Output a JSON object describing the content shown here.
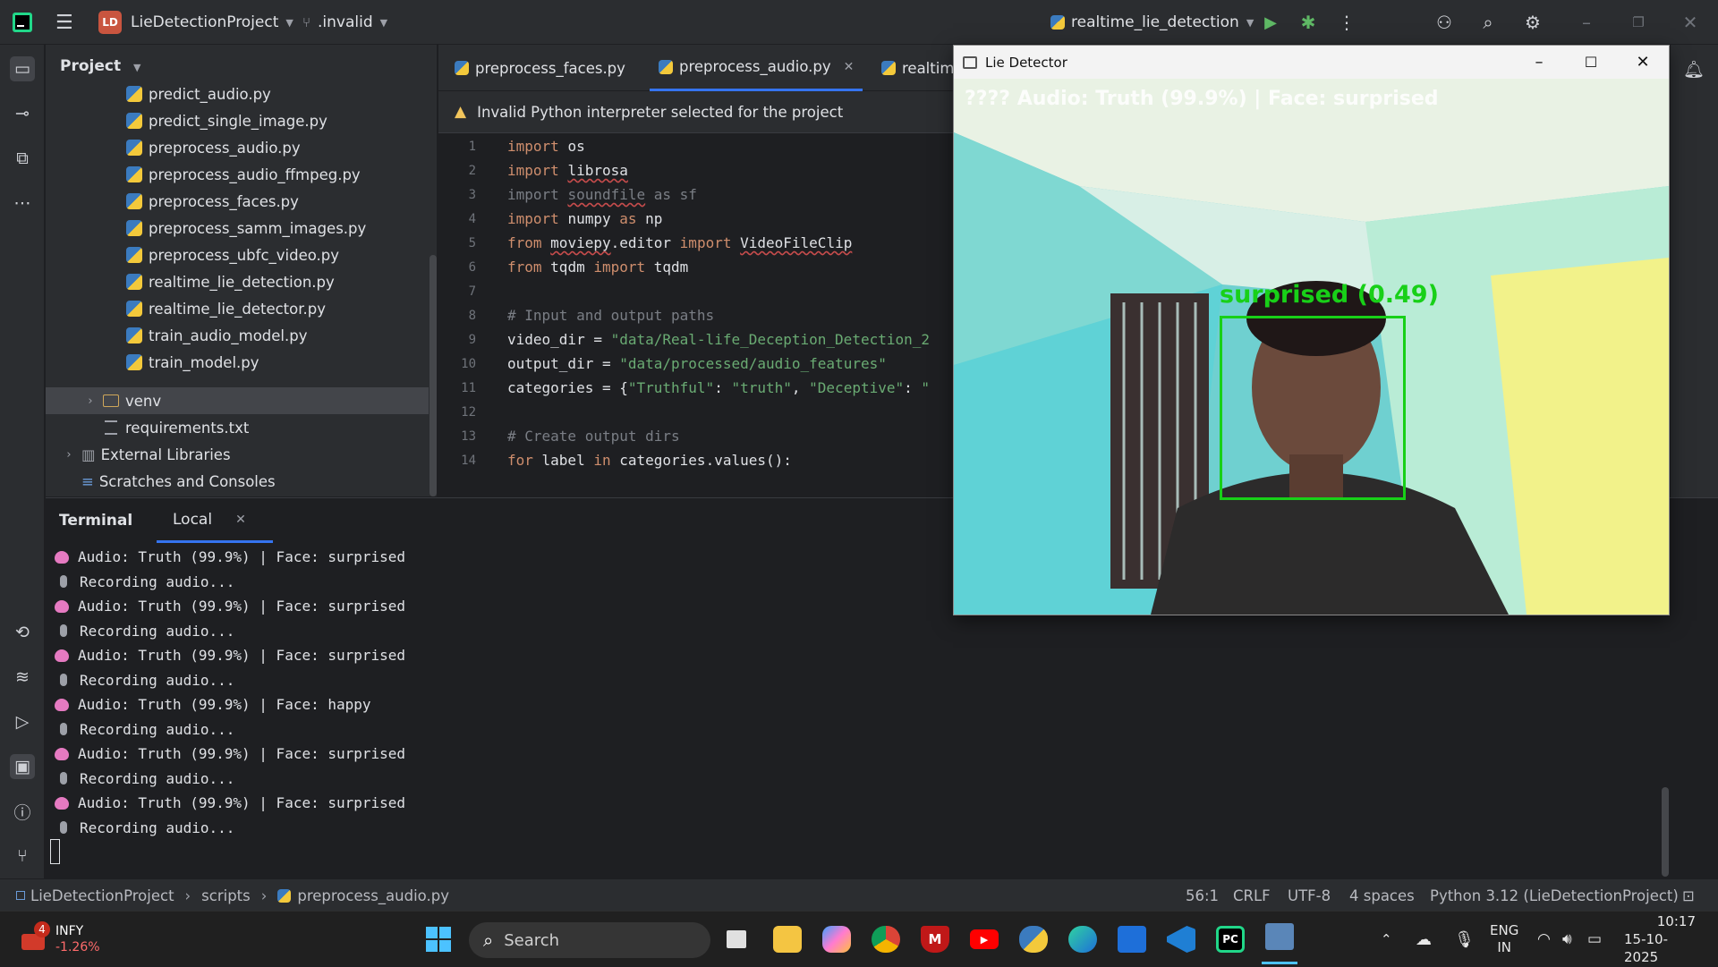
{
  "titlebar": {
    "project_badge": "LD",
    "project_name": "LieDetectionProject",
    "branch": ".invalid",
    "run_config": "realtime_lie_detection"
  },
  "project_panel": {
    "title": "Project",
    "files": [
      "predict_audio.py",
      "predict_single_image.py",
      "preprocess_audio.py",
      "preprocess_audio_ffmpeg.py",
      "preprocess_faces.py",
      "preprocess_samm_images.py",
      "preprocess_ubfc_video.py",
      "realtime_lie_detection.py",
      "realtime_lie_detector.py",
      "train_audio_model.py",
      "train_model.py"
    ],
    "venv": "venv",
    "requirements": "requirements.txt",
    "external_libraries": "External Libraries",
    "scratches": "Scratches and Consoles"
  },
  "editor": {
    "tabs": [
      {
        "label": "preprocess_faces.py",
        "active": false
      },
      {
        "label": "preprocess_audio.py",
        "active": true
      },
      {
        "label": "realtime",
        "active": false
      }
    ],
    "banner": "Invalid Python interpreter selected for the project",
    "line_numbers": [
      "1",
      "2",
      "3",
      "4",
      "5",
      "6",
      "7",
      "8",
      "9",
      "10",
      "11",
      "12",
      "13",
      "14"
    ]
  },
  "terminal": {
    "title": "Terminal",
    "tab": "Local",
    "lines": [
      {
        "type": "brain",
        "text": "Audio: Truth (99.9%) | Face: surprised"
      },
      {
        "type": "mic",
        "text": "Recording audio..."
      },
      {
        "type": "brain",
        "text": "Audio: Truth (99.9%) | Face: surprised"
      },
      {
        "type": "mic",
        "text": "Recording audio..."
      },
      {
        "type": "brain",
        "text": "Audio: Truth (99.9%) | Face: surprised"
      },
      {
        "type": "mic",
        "text": "Recording audio..."
      },
      {
        "type": "brain",
        "text": "Audio: Truth (99.9%) | Face: happy"
      },
      {
        "type": "mic",
        "text": "Recording audio..."
      },
      {
        "type": "brain",
        "text": "Audio: Truth (99.9%) | Face: surprised"
      },
      {
        "type": "mic",
        "text": "Recording audio..."
      },
      {
        "type": "brain",
        "text": "Audio: Truth (99.9%) | Face: surprised"
      },
      {
        "type": "mic",
        "text": "Recording audio..."
      }
    ]
  },
  "lie_window": {
    "title": "Lie Detector",
    "overlay": "???? Audio: Truth (99.9%) | Face: surprised",
    "face_label": "surprised (0.49)"
  },
  "statusbar": {
    "breadcrumb": [
      "LieDetectionProject",
      "scripts",
      "preprocess_audio.py"
    ],
    "position": "56:1",
    "line_ending": "CRLF",
    "encoding": "UTF-8",
    "indent": "4 spaces",
    "interpreter": "Python 3.12 (LieDetectionProject)"
  },
  "taskbar": {
    "stock_name": "INFY",
    "stock_change": "-1.26%",
    "stock_badge": "4",
    "search_placeholder": "Search",
    "language_top": "ENG",
    "language_bottom": "IN",
    "time": "10:17",
    "date": "15-10-2025"
  },
  "colors": {
    "ide_bg": "#1e1f22",
    "panel_bg": "#2b2d30",
    "accent": "#3574f0",
    "keyword": "#cf8e6d",
    "string": "#6aab73",
    "face_box": "#18d018"
  }
}
